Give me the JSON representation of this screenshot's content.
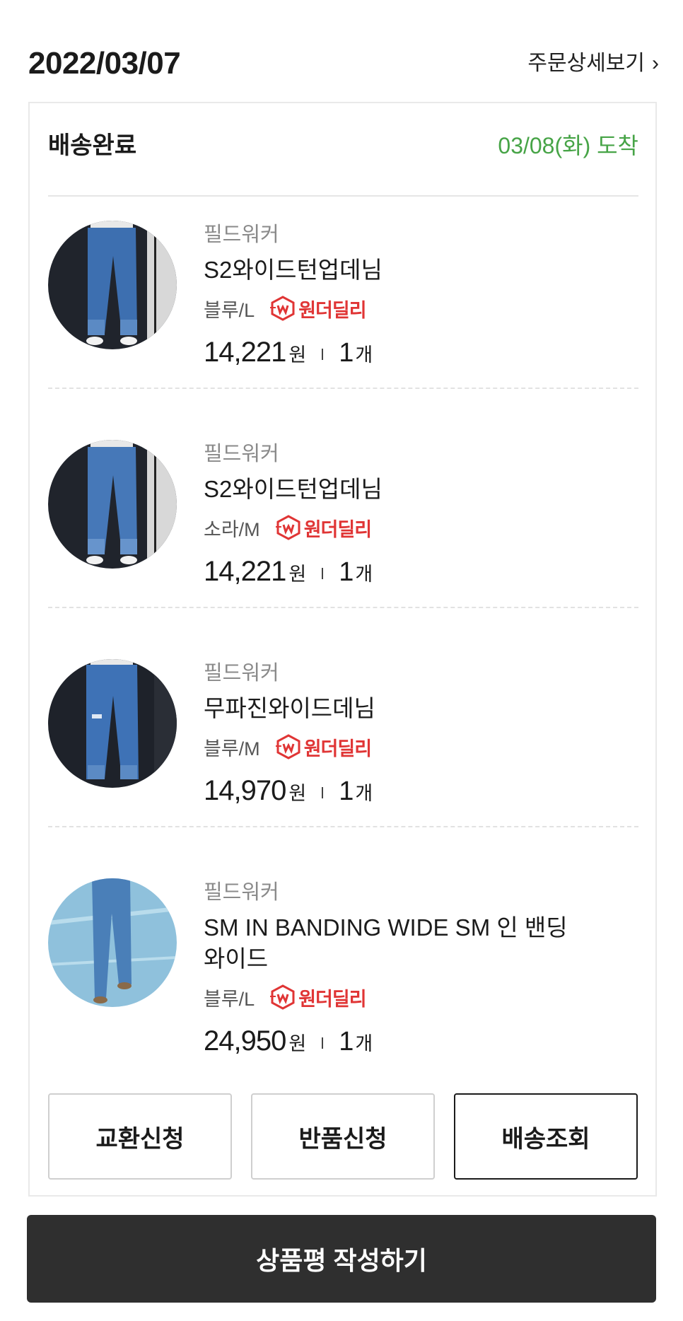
{
  "order": {
    "date": "2022/03/07",
    "detail_link": "주문상세보기",
    "status": "배송완료",
    "arrival": "03/08(화) 도착"
  },
  "colors": {
    "arrival_green": "#47a447",
    "badge_red": "#e03535",
    "primary_dark": "#2f2f2f"
  },
  "items": [
    {
      "brand": "필드워커",
      "name": "S2와이드턴업데님",
      "option": "블루/L",
      "delivery_badge": "원더딜리",
      "price": "14,221",
      "currency": "원",
      "qty": "1",
      "qty_unit": "개",
      "image": "jeans-photo"
    },
    {
      "brand": "필드워커",
      "name": "S2와이드턴업데님",
      "option": "소라/M",
      "delivery_badge": "원더딜리",
      "price": "14,221",
      "currency": "원",
      "qty": "1",
      "qty_unit": "개",
      "image": "jeans-photo"
    },
    {
      "brand": "필드워커",
      "name": "무파진와이드데님",
      "option": "블루/M",
      "delivery_badge": "원더딜리",
      "price": "14,970",
      "currency": "원",
      "qty": "1",
      "qty_unit": "개",
      "image": "jeans-photo"
    },
    {
      "brand": "필드워커",
      "name": "SM IN BANDING WIDE SM 인 밴딩",
      "name_line2": "와이드",
      "option": "블루/L",
      "delivery_badge": "원더딜리",
      "price": "24,950",
      "currency": "원",
      "qty": "1",
      "qty_unit": "개",
      "image": "jeans-photo"
    }
  ],
  "actions": {
    "exchange": "교환신청",
    "return": "반품신청",
    "tracking": "배송조회",
    "review": "상품평 작성하기"
  }
}
